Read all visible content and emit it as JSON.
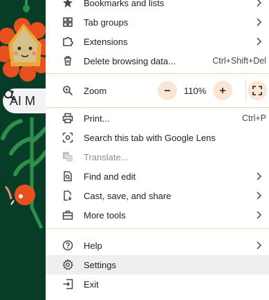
{
  "menu": {
    "items_top": [
      {
        "label": "Bookmarks and lists",
        "icon": "star-icon",
        "has_submenu": true
      },
      {
        "label": "Tab groups",
        "icon": "tab-groups-icon",
        "has_submenu": true
      },
      {
        "label": "Extensions",
        "icon": "puzzle-icon",
        "has_submenu": true
      },
      {
        "label": "Delete browsing data...",
        "icon": "trash-icon",
        "shortcut": "Ctrl+Shift+Del"
      }
    ],
    "zoom": {
      "label": "Zoom",
      "value": "110%",
      "minus": "−",
      "plus": "+"
    },
    "items_mid": [
      {
        "label": "Print...",
        "icon": "printer-icon",
        "shortcut": "Ctrl+P"
      },
      {
        "label": "Search this tab with Google Lens",
        "icon": "lens-icon"
      },
      {
        "label": "Translate...",
        "icon": "translate-icon",
        "disabled": true
      },
      {
        "label": "Find and edit",
        "icon": "find-icon",
        "has_submenu": true
      },
      {
        "label": "Cast, save, and share",
        "icon": "cast-save-icon",
        "has_submenu": true
      },
      {
        "label": "More tools",
        "icon": "toolbox-icon",
        "has_submenu": true
      }
    ],
    "items_bottom": [
      {
        "label": "Help",
        "icon": "help-icon",
        "has_submenu": true
      },
      {
        "label": "Settings",
        "icon": "gear-icon",
        "highlighted": true
      },
      {
        "label": "Exit",
        "icon": "exit-icon"
      }
    ]
  },
  "background": {
    "search_chip_text": "AI M"
  },
  "colors": {
    "page_bg": "#073d27",
    "menu_bg": "#ffffff",
    "separator": "#e6d7b8",
    "zoom_button_bg": "#fbe5d5",
    "highlight": "#efeef1"
  }
}
